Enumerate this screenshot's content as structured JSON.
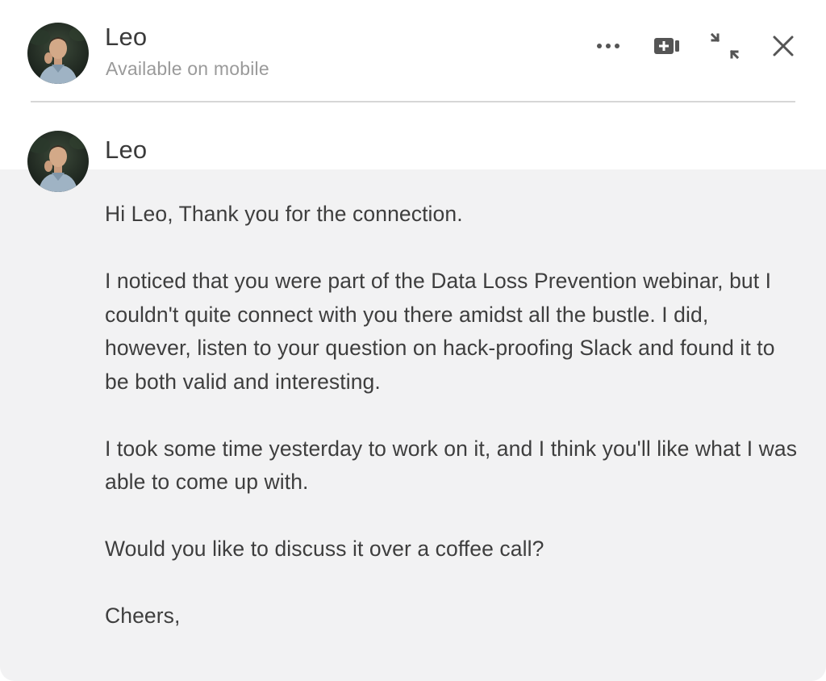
{
  "contact": {
    "name": "Leo",
    "status": "Available on mobile"
  },
  "header_actions": {
    "more_icon": "ellipsis-icon",
    "video_icon": "video-call-icon",
    "minimize_icon": "minimize-arrows-icon",
    "close_icon": "close-icon"
  },
  "message": {
    "sender": "Leo",
    "paragraphs": [
      "Hi Leo, Thank you for the connection.",
      "I noticed that you were part of the Data Loss Prevention webinar, but I couldn't quite connect with you there amidst all the bustle. I did, however, listen to your question on hack-proofing Slack and found it to be both valid and interesting.",
      "I took some time yesterday to work on it, and I think you'll like what I was able to come up with.",
      "Would you like to discuss it over a coffee call?",
      "Cheers,"
    ]
  },
  "colors": {
    "message_bg": "#f2f2f3",
    "text": "#3e3e3e",
    "muted": "#9a9a9a",
    "icon": "#555555"
  }
}
